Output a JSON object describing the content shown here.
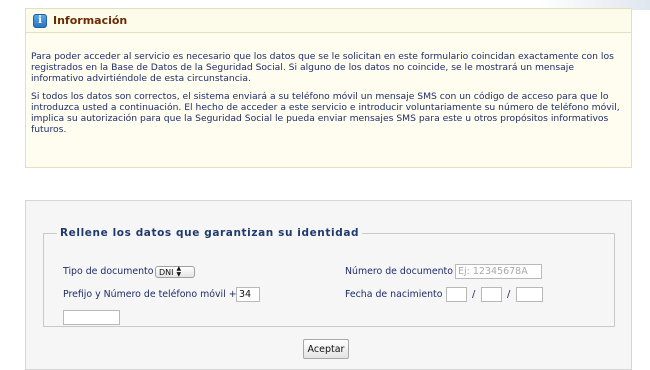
{
  "info": {
    "title": "Información",
    "icon": "info-icon",
    "paragraph_1": "Para poder acceder al servicio es necesario que los datos que se le solicitan en este formulario coincidan exactamente con los registrados en la Base de Datos de la Seguridad Social. Si alguno de los datos no coincide, se le mostrará un mensaje informativo advirtiéndole de esta circunstancia.",
    "paragraph_2": "Si todos los datos son correctos, el sistema enviará a su teléfono móvil un mensaje SMS con un código de acceso para que lo introduzca usted a continuación. El hecho de acceder a este servicio e introducir voluntariamente su número de teléfono móvil, implica su autorización para que la Seguridad Social le pueda enviar mensajes SMS para este u otros propósitos informativos futuros."
  },
  "form": {
    "legend": "Rellene los datos que garantizan su identidad",
    "doc_type_label": "Tipo de documento",
    "doc_type_value": "DNI",
    "doc_number_label": "Número de documento",
    "doc_number_placeholder": "Ej: 12345678A",
    "phone_label": "Prefijo y Número de teléfono móvil +",
    "phone_prefix_value": "34",
    "phone_number_value": "",
    "birth_label": "Fecha de nacimiento",
    "birth_day_value": "",
    "birth_month_value": "",
    "birth_year_value": "",
    "date_separator": "/",
    "submit_label": "Aceptar"
  },
  "colors": {
    "info_background": "#fffdf0",
    "info_title": "#6b2c05",
    "text": "#1f2d6b",
    "legend": "#1f3a6e"
  }
}
